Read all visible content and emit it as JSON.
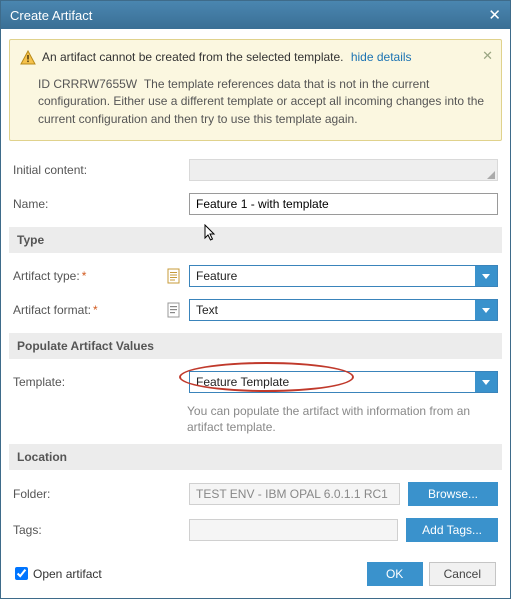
{
  "dialog": {
    "title": "Create Artifact"
  },
  "warning": {
    "message": "An artifact cannot be created from the selected template.",
    "hide_link": "hide details",
    "id_label": "ID CRRRW7655W",
    "detail": "The template references data that is not in the current configuration. Either use a different template or accept all incoming changes into the current configuration and then try to use this template again."
  },
  "labels": {
    "initial_content": "Initial content:",
    "name": "Name:",
    "type_section": "Type",
    "artifact_type": "Artifact type:",
    "artifact_format": "Artifact format:",
    "populate_section": "Populate Artifact Values",
    "template": "Template:",
    "template_help": "You can populate the artifact with information from an artifact template.",
    "location_section": "Location",
    "folder": "Folder:",
    "tags": "Tags:",
    "open_artifact": "Open artifact"
  },
  "fields": {
    "name": "Feature 1 - with template",
    "artifact_type": "Feature",
    "artifact_format": "Text",
    "template": "Feature Template",
    "folder": "TEST ENV - IBM OPAL 6.0.1.1 RC1",
    "open_artifact_checked": true
  },
  "buttons": {
    "browse": "Browse...",
    "add_tags": "Add Tags...",
    "ok": "OK",
    "cancel": "Cancel"
  }
}
